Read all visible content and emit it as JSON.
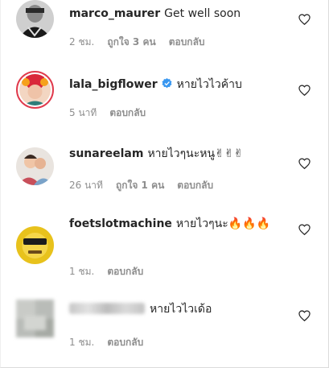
{
  "comments": [
    {
      "username": "marco_maurer",
      "text": "Get well soon",
      "time": "2 ชม.",
      "likes": "ถูกใจ 3 คน",
      "reply": "ตอบกลับ"
    },
    {
      "username": "lala_bigflower",
      "text": "หายไวไวค้าบ",
      "time": "5 นาที",
      "likes": "",
      "reply": "ตอบกลับ"
    },
    {
      "username": "sunareelam",
      "text": "หายไวๆนะหนู✌✌✌",
      "time": "26 นาที",
      "likes": "ถูกใจ 1 คน",
      "reply": "ตอบกลับ"
    },
    {
      "username": "foetslotmachine",
      "text": "หายไวๆนะ🔥🔥🔥",
      "time": "1 ชม.",
      "likes": "",
      "reply": "ตอบกลับ"
    },
    {
      "username": "",
      "text": "หายไวไวเด้อ",
      "time": "1 ชม.",
      "likes": "",
      "reply": "ตอบกลับ"
    }
  ],
  "colors": {
    "text": "#262626",
    "secondary": "#8e8e8e",
    "verified": "#3897f0",
    "story_ring": "#e03a4c"
  },
  "icons": [
    "heart-icon",
    "verified-badge-icon"
  ]
}
